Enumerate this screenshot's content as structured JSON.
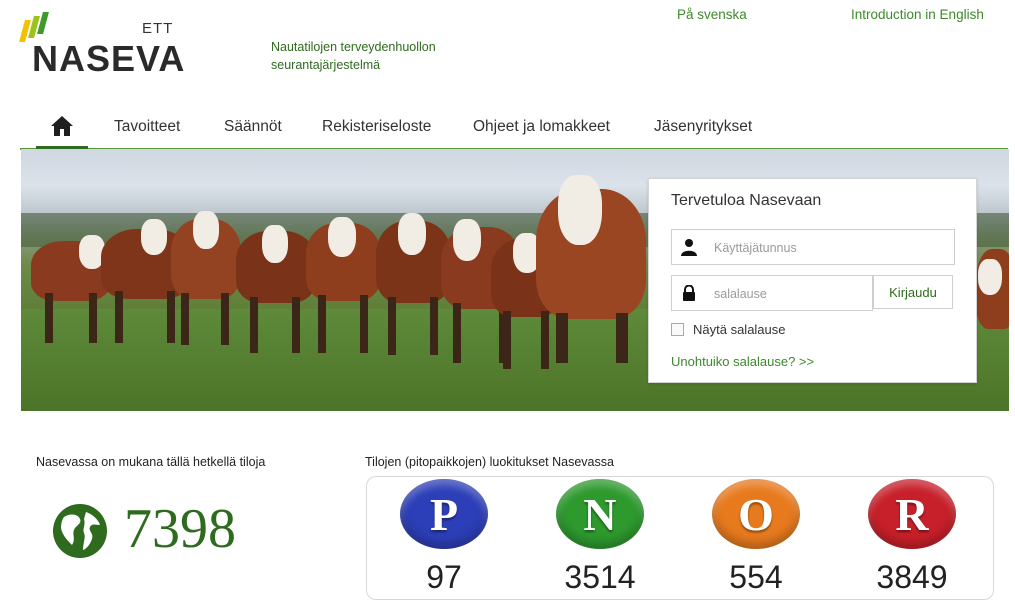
{
  "header": {
    "logo_top": "ETT",
    "logo_name": "NASEVA",
    "tagline_line1": "Nautatilojen terveydenhuollon",
    "tagline_line2": "seurantajärjestelmä",
    "lang_swedish": "På svenska",
    "lang_english": "Introduction in English"
  },
  "nav": {
    "home_icon": "home-icon",
    "items": [
      "Tavoitteet",
      "Säännöt",
      "Rekisteriseloste",
      "Ohjeet ja lomakkeet",
      "Jäsenyritykset"
    ]
  },
  "login": {
    "title": "Tervetuloa Nasevaan",
    "username_placeholder": "Käyttäjätunnus",
    "password_placeholder": "salalause",
    "submit_label": "Kirjaudu",
    "show_password_label": "Näytä salalause",
    "forgot_link": "Unohtuiko salalause? >>"
  },
  "stats": {
    "farms_label": "Nasevassa on mukana tällä hetkellä tiloja",
    "farms_count": "7398",
    "classes_label": "Tilojen (pitopaikkojen) luokitukset Nasevassa",
    "classes": [
      {
        "letter": "P",
        "count": "97",
        "color": "#2d3fb8"
      },
      {
        "letter": "N",
        "count": "3514",
        "color": "#2e9a2e"
      },
      {
        "letter": "O",
        "count": "554",
        "color": "#e87a1e"
      },
      {
        "letter": "R",
        "count": "3849",
        "color": "#c8202a"
      }
    ]
  },
  "colors": {
    "brand_green": "#2e6b1f",
    "link_green": "#3d8a2a"
  }
}
